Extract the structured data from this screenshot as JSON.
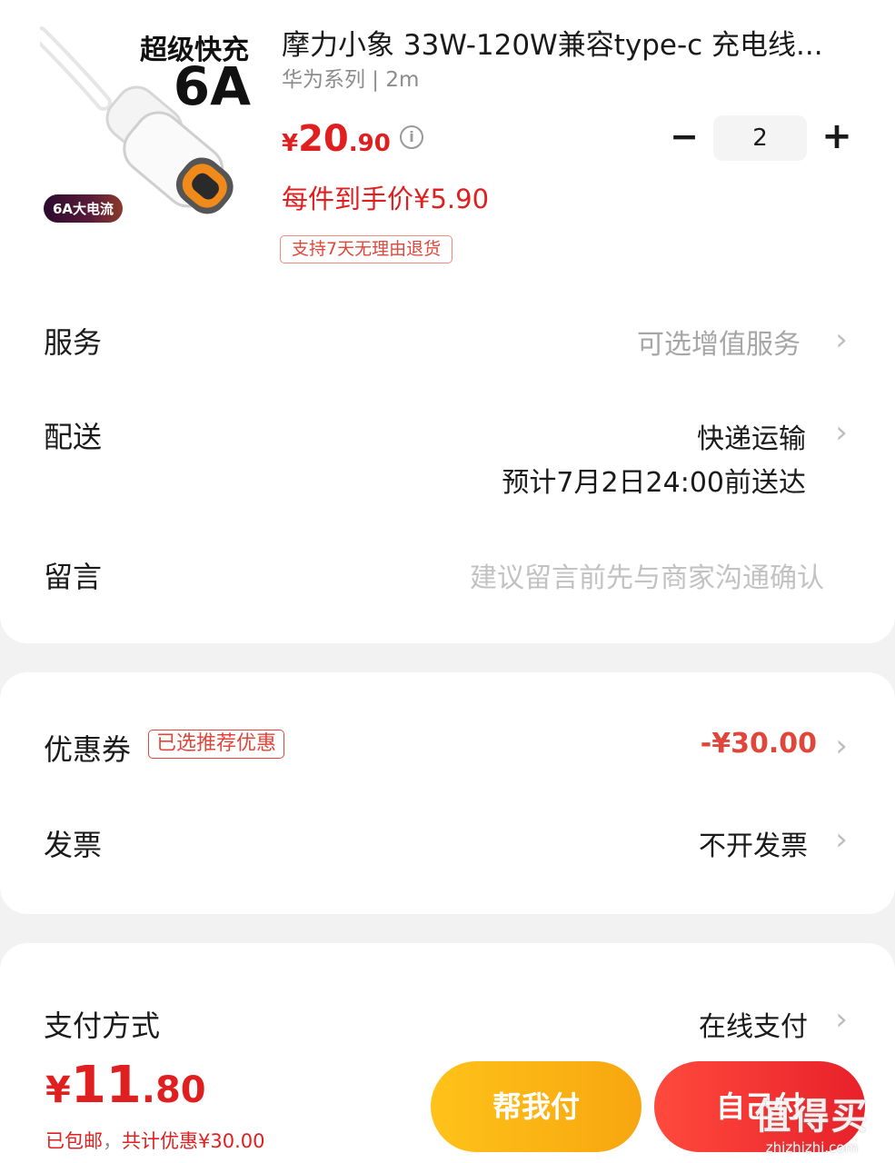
{
  "product": {
    "image_headline": "超级快充",
    "image_amp": "6A",
    "image_badge": "6A大电流",
    "title": "摩力小象 33W-120W兼容type-c 充电线...",
    "spec": "华为系列 | 2m",
    "price_currency": "¥",
    "price_int": "20",
    "price_dec": ".90",
    "info_icon": "info-icon",
    "each_price": "每件到手价¥5.90",
    "return_tag": "支持7天无理由退货",
    "quantity": "2",
    "minus": "−",
    "plus": "+"
  },
  "rows": {
    "service": {
      "label": "服务",
      "value": "可选增值服务"
    },
    "delivery": {
      "label": "配送",
      "value": "快递运输",
      "eta": "预计7月2日24:00前送达"
    },
    "message": {
      "label": "留言",
      "placeholder": "建议留言前先与商家沟通确认"
    },
    "coupon": {
      "label": "优惠券",
      "tag": "已选推荐优惠",
      "value": "-¥30.00"
    },
    "invoice": {
      "label": "发票",
      "value": "不开发票"
    },
    "payment": {
      "label": "支付方式",
      "value": "在线支付"
    }
  },
  "chevron": "›",
  "bottom": {
    "total_currency": "¥",
    "total_int": "11",
    "total_dec": ".80",
    "free_shipping": "已包邮",
    "sep": "，",
    "saving": "共计优惠¥30.00",
    "help_pay": "帮我付",
    "self_pay": "自己付"
  },
  "watermark": {
    "main": "值得买",
    "sub": "zhizhizhi.com"
  },
  "colors": {
    "accent_red": "#e02020",
    "help_btn": "#ffc21a",
    "self_btn": "#ff4a3d",
    "muted": "#8c8c8c"
  }
}
